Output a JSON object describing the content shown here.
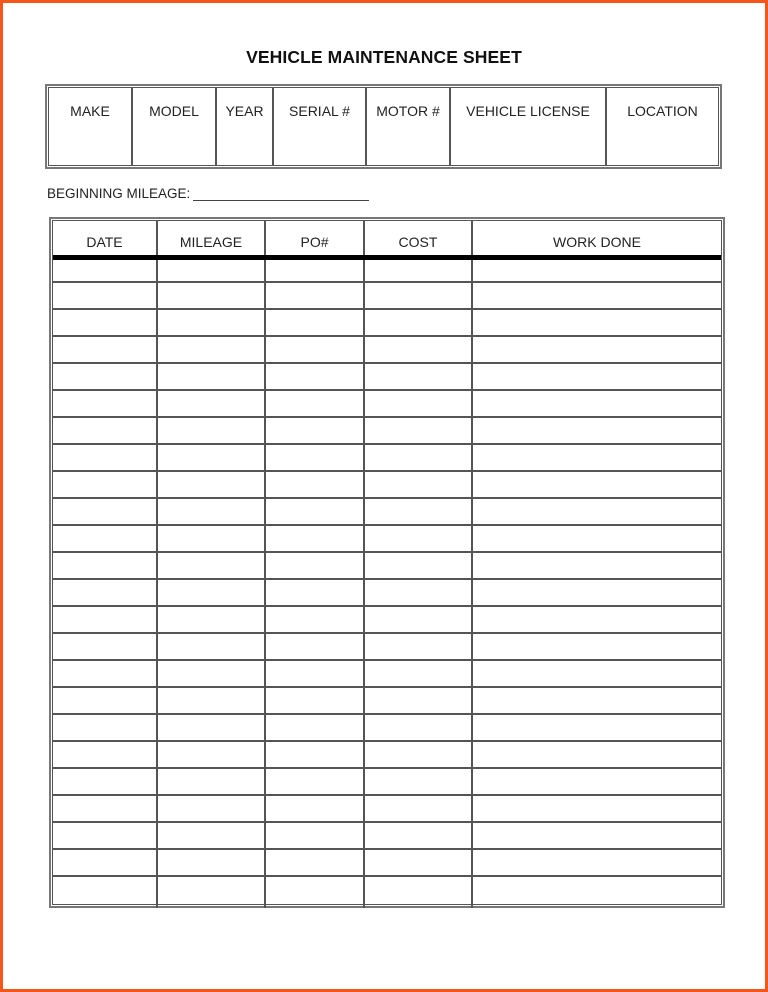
{
  "document": {
    "title": "VEHICLE MAINTENANCE SHEET",
    "accent_border_color": "#f4561c"
  },
  "vehicle_info": {
    "columns": [
      {
        "label": "MAKE",
        "value": ""
      },
      {
        "label": "MODEL",
        "value": ""
      },
      {
        "label": "YEAR",
        "value": ""
      },
      {
        "label": "SERIAL #",
        "value": ""
      },
      {
        "label": "MOTOR #",
        "value": ""
      },
      {
        "label": "VEHICLE LICENSE",
        "value": ""
      },
      {
        "label": "LOCATION",
        "value": ""
      }
    ]
  },
  "beginning_mileage": {
    "label": "BEGINNING MILEAGE:",
    "value": ""
  },
  "maintenance_log": {
    "columns": [
      "DATE",
      "MILEAGE",
      "PO#",
      "COST",
      "WORK DONE"
    ],
    "row_count": 24,
    "rows": [
      [
        "",
        "",
        "",
        "",
        ""
      ],
      [
        "",
        "",
        "",
        "",
        ""
      ],
      [
        "",
        "",
        "",
        "",
        ""
      ],
      [
        "",
        "",
        "",
        "",
        ""
      ],
      [
        "",
        "",
        "",
        "",
        ""
      ],
      [
        "",
        "",
        "",
        "",
        ""
      ],
      [
        "",
        "",
        "",
        "",
        ""
      ],
      [
        "",
        "",
        "",
        "",
        ""
      ],
      [
        "",
        "",
        "",
        "",
        ""
      ],
      [
        "",
        "",
        "",
        "",
        ""
      ],
      [
        "",
        "",
        "",
        "",
        ""
      ],
      [
        "",
        "",
        "",
        "",
        ""
      ],
      [
        "",
        "",
        "",
        "",
        ""
      ],
      [
        "",
        "",
        "",
        "",
        ""
      ],
      [
        "",
        "",
        "",
        "",
        ""
      ],
      [
        "",
        "",
        "",
        "",
        ""
      ],
      [
        "",
        "",
        "",
        "",
        ""
      ],
      [
        "",
        "",
        "",
        "",
        ""
      ],
      [
        "",
        "",
        "",
        "",
        ""
      ],
      [
        "",
        "",
        "",
        "",
        ""
      ],
      [
        "",
        "",
        "",
        "",
        ""
      ],
      [
        "",
        "",
        "",
        "",
        ""
      ],
      [
        "",
        "",
        "",
        "",
        ""
      ],
      [
        "",
        "",
        "",
        "",
        ""
      ]
    ]
  }
}
